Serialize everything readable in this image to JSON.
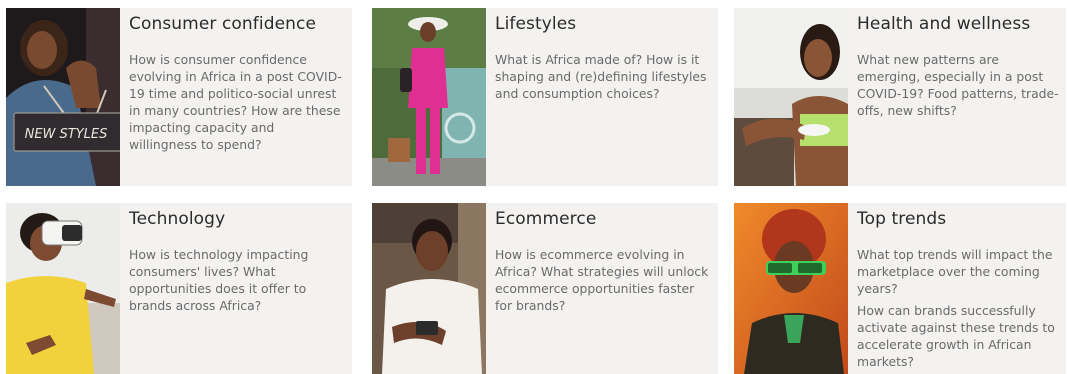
{
  "cards": [
    {
      "title": "Consumer confidence",
      "paragraphs": [
        "How is consumer confidence evolving in Africa in a post COVID-19 time and politico-social unrest in many countries? How are these impacting capacity and willingness to spend?"
      ],
      "photo_sign": "NEW STYLES"
    },
    {
      "title": "Lifestyles",
      "paragraphs": [
        "What is Africa made of? How is it shaping and (re)defining lifestyles and consumption choices?"
      ]
    },
    {
      "title": "Health and wellness",
      "paragraphs": [
        "What new patterns are emerging, especially in a post COVID-19? Food patterns, trade-offs, new shifts?"
      ]
    },
    {
      "title": "Technology",
      "paragraphs": [
        "How is technology impacting consumers' lives? What opportunities does it offer to brands across Africa?"
      ]
    },
    {
      "title": "Ecommerce",
      "paragraphs": [
        "How is ecommerce evolving in Africa? What strategies will unlock ecommerce opportunities faster for brands?"
      ]
    },
    {
      "title": "Top trends",
      "paragraphs": [
        "What top trends will impact the marketplace over the coming years?",
        "How can brands successfully activate against these trends to accelerate growth in African markets?"
      ]
    }
  ]
}
